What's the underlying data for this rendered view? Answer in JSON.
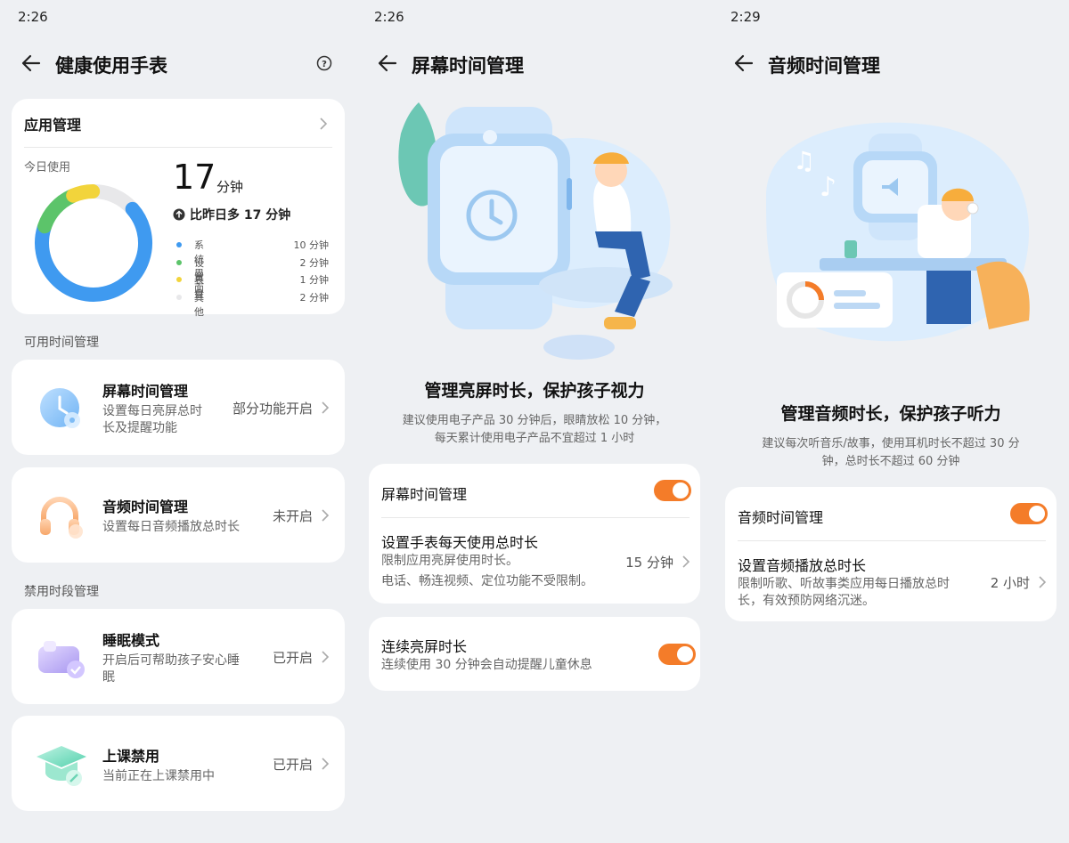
{
  "panel1": {
    "time": "2:26",
    "title": "健康使用手表",
    "app_mgmt": {
      "title": "应用管理",
      "today_label": "今日使用",
      "total_value": "17",
      "total_unit": "分钟",
      "compare": "比昨日多 17 分钟",
      "legend": [
        {
          "label": "系统界面",
          "value": "10 分钟",
          "color": "#3f9af0"
        },
        {
          "label": "设置",
          "value": "2 分钟",
          "color": "#5cc46a"
        },
        {
          "label": "表盘",
          "value": "1 分钟",
          "color": "#f2d43b"
        },
        {
          "label": "其他",
          "value": "2 分钟",
          "color": "#e8e8ea"
        }
      ]
    },
    "section_available": "可用时间管理",
    "screen_item": {
      "title": "屏幕时间管理",
      "sub1": "设置每日亮屏总时",
      "sub2": "长及提醒功能",
      "status": "部分功能开启"
    },
    "audio_item": {
      "title": "音频时间管理",
      "sub1": "设置每日音频播放总时长",
      "status": "未开启"
    },
    "section_forbidden": "禁用时段管理",
    "sleep_item": {
      "title": "睡眠模式",
      "sub1": "开启后可帮助孩子安心睡",
      "sub2": "眠",
      "status": "已开启"
    },
    "class_item": {
      "title": "上课禁用",
      "sub1": "当前正在上课禁用中",
      "status": "已开启"
    }
  },
  "panel2": {
    "time": "2:26",
    "title": "屏幕时间管理",
    "headline": "管理亮屏时长，保护孩子视力",
    "desc1": "建议使用电子产品 30 分钟后，眼睛放松 10 分钟，",
    "desc2": "每天累计使用电子产品不宜超过 1 小时",
    "toggle_label": "屏幕时间管理",
    "daily_title": "设置手表每天使用总时长",
    "daily_sub1": "限制应用亮屏使用时长。",
    "daily_sub2": "电话、畅连视频、定位功能不受限制。",
    "daily_value": "15 分钟",
    "continuous_title": "连续亮屏时长",
    "continuous_sub": "连续使用 30 分钟会自动提醒儿童休息"
  },
  "panel3": {
    "time": "2:29",
    "title": "音频时间管理",
    "headline": "管理音频时长，保护孩子听力",
    "desc1": "建议每次听音乐/故事，使用耳机时长不超过 30 分",
    "desc2": "钟，总时长不超过 60 分钟",
    "toggle_label": "音频时间管理",
    "total_title": "设置音频播放总时长",
    "total_sub1": "限制听歌、听故事类应用每日播放总时",
    "total_sub2": "长，有效预防网络沉迷。",
    "total_value": "2 小时"
  },
  "chart_data": {
    "type": "pie",
    "categories": [
      "系统界面",
      "设置",
      "表盘",
      "其他"
    ],
    "values": [
      10,
      2,
      1,
      2
    ]
  }
}
